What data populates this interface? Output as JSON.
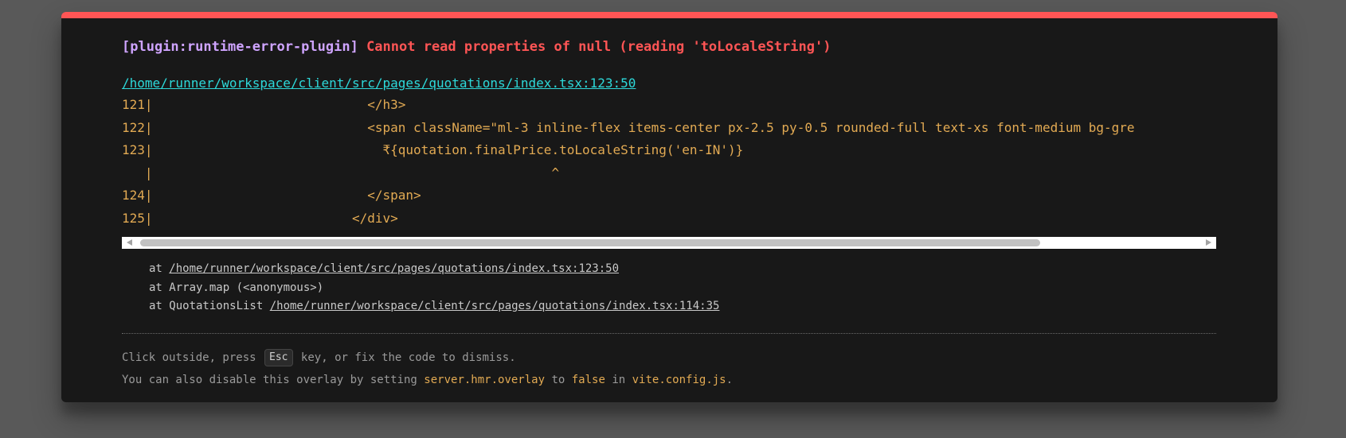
{
  "error": {
    "plugin": "[plugin:runtime-error-plugin]",
    "message": "Cannot read properties of null (reading 'toLocaleString')",
    "file": "/home/runner/workspace/client/src/pages/quotations/index.tsx:123:50"
  },
  "frame": {
    "lines": [
      "121|                            </h3>",
      "122|                            <span className=\"ml-3 inline-flex items-center px-2.5 py-0.5 rounded-full text-xs font-medium bg-gre",
      "123|                              ₹{quotation.finalPrice.toLocaleString('en-IN')}",
      "   |                                                    ^",
      "124|                            </span>",
      "125|                          </div>"
    ]
  },
  "stack": [
    {
      "prefix": "at ",
      "func": "",
      "file": "/home/runner/workspace/client/src/pages/quotations/index.tsx:123:50"
    },
    {
      "prefix": "at Array.map (<anonymous>)",
      "func": "",
      "file": ""
    },
    {
      "prefix": "at QuotationsList ",
      "func": "",
      "file": "/home/runner/workspace/client/src/pages/quotations/index.tsx:114:35"
    }
  ],
  "tip": {
    "line1_a": "Click outside, press ",
    "line1_key": "Esc",
    "line1_b": " key, or fix the code to dismiss.",
    "line2_a": "You can also disable this overlay by setting ",
    "line2_code1": "server.hmr.overlay",
    "line2_b": " to ",
    "line2_code2": "false",
    "line2_c": " in ",
    "line2_code3": "vite.config.js",
    "line2_d": "."
  },
  "colors": {
    "accent_red": "#ff5555",
    "plugin_purple": "#cfa4ff",
    "link_cyan": "#2dd9da",
    "code_yellow": "#e2aa53",
    "backdrop": "#595959",
    "window_bg": "#181818"
  }
}
